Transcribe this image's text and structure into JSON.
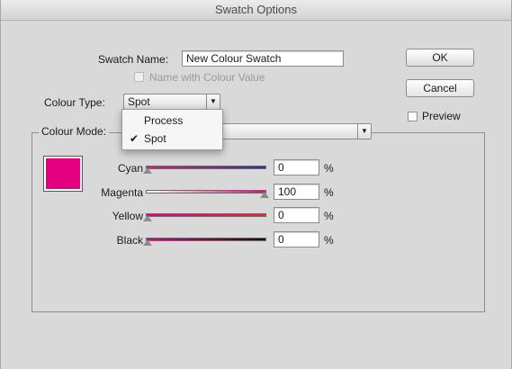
{
  "window": {
    "title": "Swatch Options"
  },
  "swatch_name": {
    "label": "Swatch Name:",
    "value": "New Colour Swatch"
  },
  "name_with_colour_value": {
    "label": "Name with Colour Value",
    "checked": false,
    "enabled": false
  },
  "colour_type": {
    "label": "Colour Type:",
    "selected": "Spot",
    "options": [
      "Process",
      "Spot"
    ]
  },
  "colour_mode": {
    "label": "Colour Mode:"
  },
  "buttons": {
    "ok": "OK",
    "cancel": "Cancel"
  },
  "preview": {
    "label": "Preview",
    "checked": false
  },
  "swatch_color": "#e3007e",
  "sliders": [
    {
      "label": "Cyan",
      "value": "0",
      "unit": "%",
      "from": "#d61e6f",
      "to": "#2e3690",
      "fraction": 0
    },
    {
      "label": "Magenta",
      "value": "100",
      "unit": "%",
      "from": "#ffffff",
      "to": "#e3007e",
      "fraction": 1
    },
    {
      "label": "Yellow",
      "value": "0",
      "unit": "%",
      "from": "#e3007e",
      "to": "#e4263b",
      "fraction": 0
    },
    {
      "label": "Black",
      "value": "0",
      "unit": "%",
      "from": "#e3007e",
      "to": "#111111",
      "fraction": 0
    }
  ]
}
